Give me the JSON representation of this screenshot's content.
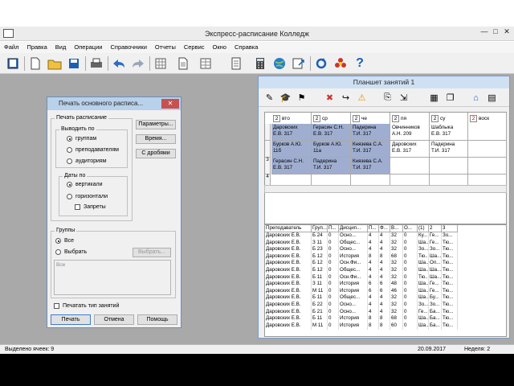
{
  "app": {
    "title": "Экспресс-расписание Колледж",
    "window_controls": [
      "—",
      "□",
      "✕"
    ]
  },
  "menu": [
    "Файл",
    "Правка",
    "Вид",
    "Операции",
    "Справочники",
    "Отчеты",
    "Сервис",
    "Окно",
    "Справка"
  ],
  "toolbar_icons": [
    "book-icon",
    "new-file-icon",
    "open-folder-icon",
    "save-icon",
    "print-icon",
    "undo-icon",
    "redo-icon",
    "grid-icon",
    "document-icon",
    "calculator-icon",
    "globe-icon",
    "export-icon",
    "refresh-icon",
    "flower-icon",
    "help-icon"
  ],
  "dialog": {
    "title": "Печать основного расписа...",
    "close": "✕",
    "group_print": "Печать расписание",
    "group_output": "Выводить по",
    "output_options": [
      "группам",
      "преподавателям",
      "аудиториям"
    ],
    "group_dates": "Даты по",
    "date_options": [
      "вертикали",
      "горизонтали"
    ],
    "bans_label": "Запреты",
    "btn_params": "Параметры...",
    "btn_time": "Время...",
    "btn_fractions": "С дробями",
    "group_groups": "Группы",
    "groups_options": [
      "Все",
      "Выбрать"
    ],
    "btn_choose": "Выбрать...",
    "groups_text": "Все",
    "print_type_label": "Печатать тип занятий",
    "btn_print": "Печать",
    "btn_cancel": "Отмена",
    "btn_help": "Помощь"
  },
  "planshet": {
    "title": "Планшет занятий 1",
    "days": [
      {
        "num": "2",
        "name": "вто"
      },
      {
        "num": "2",
        "name": "ср"
      },
      {
        "num": "2",
        "name": "че"
      },
      {
        "num": "2",
        "name": "пя"
      },
      {
        "num": "2",
        "name": "су"
      },
      {
        "num": "2",
        "name": "воск"
      }
    ],
    "rows": [
      {
        "num": "",
        "cells": [
          {
            "text": [
              "Даровских",
              "Е.В.   317"
            ],
            "sel": true
          },
          {
            "text": [
              "Герасин С.Н.",
              "Е.В.   317"
            ],
            "sel": true
          },
          {
            "text": [
              "Падерина",
              "Т.И.   317"
            ],
            "sel": true
          },
          {
            "text": [
              "Овчинников",
              "А.Н.   209"
            ],
            "sel": false
          },
          {
            "text": [
              "Шаблыка",
              "Е.В.   317"
            ],
            "sel": false
          },
          {
            "text": [
              "",
              ""
            ],
            "sel": false
          }
        ]
      },
      {
        "num": "",
        "cells": [
          {
            "text": [
              "Бурков А.Ю.",
              "11б"
            ],
            "sel": true
          },
          {
            "text": [
              "Бурков А.Ю.",
              "11а"
            ],
            "sel": true
          },
          {
            "text": [
              "Князева С.А.",
              "Т.И.   317"
            ],
            "sel": true
          },
          {
            "text": [
              "Даровских",
              "Е.В.   317"
            ],
            "sel": false
          },
          {
            "text": [
              "Падерина",
              "Т.И.   317"
            ],
            "sel": false
          },
          {
            "text": [
              "",
              ""
            ],
            "sel": false
          }
        ]
      },
      {
        "num": "3",
        "cells": [
          {
            "text": [
              "Герасин С.Н.",
              "Е.В.   317"
            ],
            "sel": true
          },
          {
            "text": [
              "Падерина",
              "Т.И.   317"
            ],
            "sel": true
          },
          {
            "text": [
              "Князева С.А.",
              "Т.И.   317"
            ],
            "sel": true
          },
          {
            "text": [
              "",
              ""
            ],
            "sel": false
          },
          {
            "text": [
              "",
              ""
            ],
            "sel": false
          },
          {
            "text": [
              "",
              ""
            ],
            "sel": false
          }
        ]
      },
      {
        "num": "4",
        "cells": [
          {
            "text": [
              "",
              ""
            ],
            "sel": false
          },
          {
            "text": [
              "",
              ""
            ],
            "sel": false
          },
          {
            "text": [
              "",
              ""
            ],
            "sel": false
          },
          {
            "text": [
              "",
              ""
            ],
            "sel": false
          },
          {
            "text": [
              "",
              ""
            ],
            "sel": false
          },
          {
            "text": [
              "",
              ""
            ],
            "sel": false
          }
        ]
      }
    ],
    "columns": [
      "Преподаватель",
      "Груп...",
      "П...",
      "Дисцип...",
      "П...",
      "Ф...",
      "В...",
      "О...",
      "(1)",
      "2",
      "3"
    ],
    "table": [
      [
        "Даровских Е.В.",
        "Б 24",
        "0",
        "Осно...",
        "4",
        "4",
        "32",
        "0",
        "Ку...",
        "Ге...",
        "Зо..."
      ],
      [
        "Даровских Е.В.",
        "З 11",
        "0",
        "Общес...",
        "4",
        "4",
        "32",
        "0",
        "Ша...",
        "Ге...",
        "Тю..."
      ],
      [
        "Даровских Е.В.",
        "Б 23",
        "0",
        "Осно...",
        "4",
        "4",
        "32",
        "0",
        "Зо...",
        "Зо...",
        "Тю..."
      ],
      [
        "Даровских Е.В.",
        "Б 12",
        "0",
        "История",
        "8",
        "8",
        "68",
        "0",
        "Тю...",
        "Ша...",
        "Тю..."
      ],
      [
        "Даровских Е.В.",
        "Б 12",
        "0",
        "Осн.Фи...",
        "4",
        "4",
        "32",
        "0",
        "Ша...",
        "Оп...",
        "Тю..."
      ],
      [
        "Даровских Е.В.",
        "Б 12",
        "0",
        "Общес...",
        "4",
        "4",
        "32",
        "0",
        "Ша...",
        "Ша...",
        "Тю..."
      ],
      [
        "Даровских Е.В.",
        "Б 11",
        "0",
        "Осн.Фи...",
        "4",
        "4",
        "32",
        "0",
        "Тю...",
        "Ша...",
        "Тю..."
      ],
      [
        "Даровских Е.В.",
        "З 11",
        "0",
        "История",
        "6",
        "6",
        "48",
        "0",
        "Ша...",
        "Ге...",
        "Тю..."
      ],
      [
        "Даровских Е.В.",
        "М 11",
        "0",
        "История",
        "6",
        "6",
        "46",
        "0",
        "Ша...",
        "Ге...",
        "Тю..."
      ],
      [
        "Даровских Е.В.",
        "Б 11",
        "0",
        "Общес...",
        "4",
        "4",
        "32",
        "0",
        "Ша...",
        "Бу...",
        "Тю..."
      ],
      [
        "Даровских Е.В.",
        "Б 22",
        "0",
        "Осно...",
        "4",
        "4",
        "32",
        "0",
        "Зо...",
        "Зо...",
        "Тю..."
      ],
      [
        "Даровских Е.В.",
        "Б 21",
        "0",
        "Осно...",
        "4",
        "4",
        "32",
        "0",
        "Ге...",
        "Ба...",
        "Тю..."
      ],
      [
        "Даровских Е.В.",
        "Б 11",
        "0",
        "История",
        "8",
        "8",
        "68",
        "0",
        "Ша...",
        "Ба...",
        "Тю..."
      ],
      [
        "Даровских Е.В.",
        "М 11",
        "0",
        "История",
        "8",
        "8",
        "60",
        "0",
        "Ша...",
        "Ба...",
        "Тю..."
      ]
    ]
  },
  "status": {
    "selected": "Выделено ячеек: 9",
    "date": "20.09.2017",
    "week": "Неделя: 2"
  }
}
